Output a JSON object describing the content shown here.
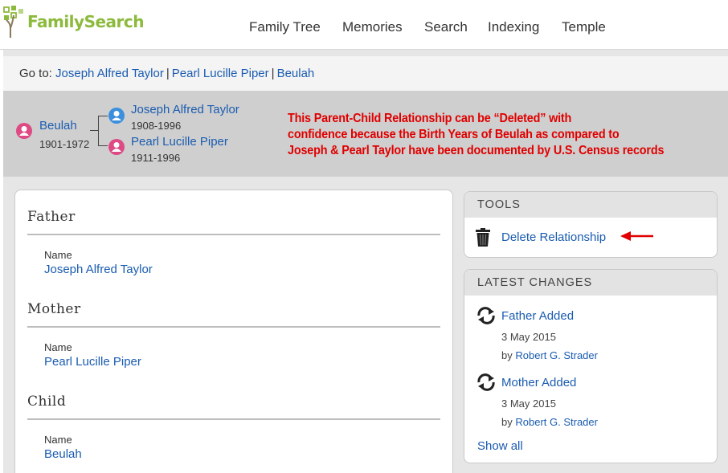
{
  "brand": {
    "logo_text": "FamilySearch"
  },
  "nav": {
    "items": [
      "Family Tree",
      "Memories",
      "Search",
      "Indexing",
      "Temple"
    ]
  },
  "goto": {
    "label": "Go to:",
    "links": [
      "Joseph Alfred Taylor",
      "Pearl Lucille Piper",
      "Beulah"
    ],
    "separator": "|"
  },
  "family": {
    "child": {
      "name": "Beulah",
      "years": "1901-1972"
    },
    "father": {
      "name": "Joseph Alfred Taylor",
      "years": "1908-1996"
    },
    "mother": {
      "name": "Pearl Lucille Piper",
      "years": "1911-1996"
    }
  },
  "annotation": {
    "lines": [
      "This Parent-Child Relationship can be “Deleted” with",
      "confidence because the Birth Years of Beulah as compared to",
      "Joseph & Pearl Taylor have been documented by U.S. Census records"
    ]
  },
  "sections": [
    {
      "title": "Father",
      "field_label": "Name",
      "value": "Joseph Alfred Taylor"
    },
    {
      "title": "Mother",
      "field_label": "Name",
      "value": "Pearl Lucille Piper"
    },
    {
      "title": "Child",
      "field_label": "Name",
      "value": "Beulah"
    }
  ],
  "tools": {
    "header": "TOOLS",
    "delete_label": "Delete Relationship"
  },
  "latest_changes": {
    "header": "LATEST CHANGES",
    "items": [
      {
        "title": "Father Added",
        "date": "3 May 2015",
        "by_label": "by",
        "by_name": "Robert G. Strader"
      },
      {
        "title": "Mother Added",
        "date": "3 May 2015",
        "by_label": "by",
        "by_name": "Robert G. Strader"
      }
    ],
    "show_all": "Show all"
  },
  "colors": {
    "link": "#1a5cb0",
    "brand_green": "#8cba3c",
    "female_avatar": "#dd4a84",
    "male_avatar": "#3b8fdd",
    "annotation_red": "#e00000"
  }
}
